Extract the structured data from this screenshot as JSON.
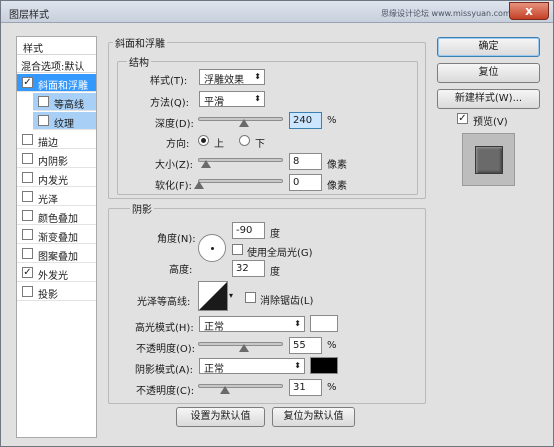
{
  "window": {
    "title": "图层样式",
    "watermark": "思缘设计论坛 www.missyuan.com",
    "close": "x"
  },
  "styles": {
    "header": "样式",
    "blending": "混合选项:默认",
    "items": [
      {
        "label": "斜面和浮雕",
        "checked": true
      },
      {
        "label": "等高线",
        "checked": false
      },
      {
        "label": "纹理",
        "checked": false
      },
      {
        "label": "描边",
        "checked": false
      },
      {
        "label": "内阴影",
        "checked": false
      },
      {
        "label": "内发光",
        "checked": false
      },
      {
        "label": "光泽",
        "checked": false
      },
      {
        "label": "颜色叠加",
        "checked": false
      },
      {
        "label": "渐变叠加",
        "checked": false
      },
      {
        "label": "图案叠加",
        "checked": false
      },
      {
        "label": "外发光",
        "checked": true
      },
      {
        "label": "投影",
        "checked": false
      }
    ],
    "check_mark": "✓"
  },
  "bevel": {
    "group_title": "斜面和浮雕",
    "structure_title": "结构",
    "style_label": "样式(T):",
    "style_value": "浮雕效果",
    "technique_label": "方法(Q):",
    "technique_value": "平滑",
    "depth_label": "深度(D):",
    "depth_value": "240",
    "depth_unit": "%",
    "direction_label": "方向:",
    "dir_up": "上",
    "dir_down": "下",
    "size_label": "大小(Z):",
    "size_value": "8",
    "size_unit": "像素",
    "soften_label": "软化(F):",
    "soften_value": "0",
    "soften_unit": "像素"
  },
  "shading": {
    "title": "阴影",
    "angle_label": "角度(N):",
    "angle_value": "-90",
    "angle_unit": "度",
    "global_light": "使用全局光(G)",
    "altitude_label": "高度:",
    "altitude_value": "32",
    "altitude_unit": "度",
    "gloss_label": "光泽等高线:",
    "antialias": "消除锯齿(L)",
    "highlight_label": "高光模式(H):",
    "highlight_mode": "正常",
    "highlight_color": "#ffffff",
    "highlight_opacity_label": "不透明度(O):",
    "highlight_opacity": "55",
    "shadow_label": "阴影模式(A):",
    "shadow_mode": "正常",
    "shadow_color": "#000000",
    "shadow_opacity_label": "不透明度(C):",
    "shadow_opacity": "31",
    "percent": "%"
  },
  "footer": {
    "set_default": "设置为默认值",
    "reset_default": "复位为默认值"
  },
  "actions": {
    "ok": "确定",
    "reset": "复位",
    "new_style": "新建样式(W)...",
    "preview": "预览(V)"
  }
}
